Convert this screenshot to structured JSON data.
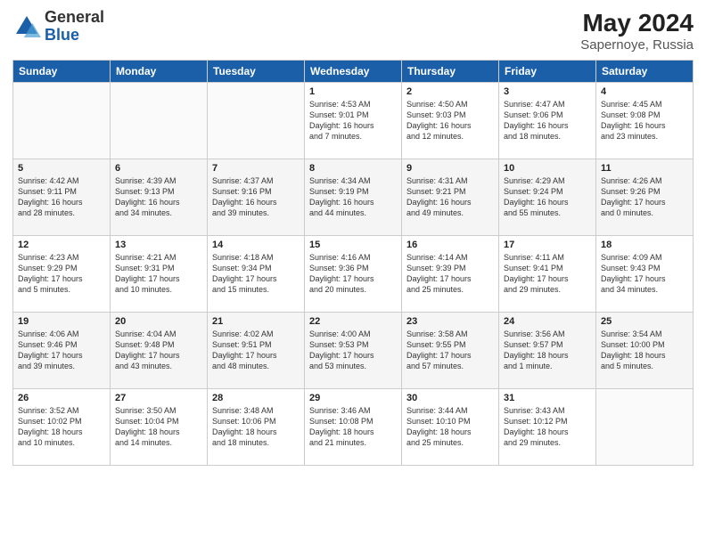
{
  "logo": {
    "general": "General",
    "blue": "Blue"
  },
  "title": "May 2024",
  "subtitle": "Sapernoye, Russia",
  "headers": [
    "Sunday",
    "Monday",
    "Tuesday",
    "Wednesday",
    "Thursday",
    "Friday",
    "Saturday"
  ],
  "weeks": [
    [
      {
        "day": "",
        "info": ""
      },
      {
        "day": "",
        "info": ""
      },
      {
        "day": "",
        "info": ""
      },
      {
        "day": "1",
        "info": "Sunrise: 4:53 AM\nSunset: 9:01 PM\nDaylight: 16 hours\nand 7 minutes."
      },
      {
        "day": "2",
        "info": "Sunrise: 4:50 AM\nSunset: 9:03 PM\nDaylight: 16 hours\nand 12 minutes."
      },
      {
        "day": "3",
        "info": "Sunrise: 4:47 AM\nSunset: 9:06 PM\nDaylight: 16 hours\nand 18 minutes."
      },
      {
        "day": "4",
        "info": "Sunrise: 4:45 AM\nSunset: 9:08 PM\nDaylight: 16 hours\nand 23 minutes."
      }
    ],
    [
      {
        "day": "5",
        "info": "Sunrise: 4:42 AM\nSunset: 9:11 PM\nDaylight: 16 hours\nand 28 minutes."
      },
      {
        "day": "6",
        "info": "Sunrise: 4:39 AM\nSunset: 9:13 PM\nDaylight: 16 hours\nand 34 minutes."
      },
      {
        "day": "7",
        "info": "Sunrise: 4:37 AM\nSunset: 9:16 PM\nDaylight: 16 hours\nand 39 minutes."
      },
      {
        "day": "8",
        "info": "Sunrise: 4:34 AM\nSunset: 9:19 PM\nDaylight: 16 hours\nand 44 minutes."
      },
      {
        "day": "9",
        "info": "Sunrise: 4:31 AM\nSunset: 9:21 PM\nDaylight: 16 hours\nand 49 minutes."
      },
      {
        "day": "10",
        "info": "Sunrise: 4:29 AM\nSunset: 9:24 PM\nDaylight: 16 hours\nand 55 minutes."
      },
      {
        "day": "11",
        "info": "Sunrise: 4:26 AM\nSunset: 9:26 PM\nDaylight: 17 hours\nand 0 minutes."
      }
    ],
    [
      {
        "day": "12",
        "info": "Sunrise: 4:23 AM\nSunset: 9:29 PM\nDaylight: 17 hours\nand 5 minutes."
      },
      {
        "day": "13",
        "info": "Sunrise: 4:21 AM\nSunset: 9:31 PM\nDaylight: 17 hours\nand 10 minutes."
      },
      {
        "day": "14",
        "info": "Sunrise: 4:18 AM\nSunset: 9:34 PM\nDaylight: 17 hours\nand 15 minutes."
      },
      {
        "day": "15",
        "info": "Sunrise: 4:16 AM\nSunset: 9:36 PM\nDaylight: 17 hours\nand 20 minutes."
      },
      {
        "day": "16",
        "info": "Sunrise: 4:14 AM\nSunset: 9:39 PM\nDaylight: 17 hours\nand 25 minutes."
      },
      {
        "day": "17",
        "info": "Sunrise: 4:11 AM\nSunset: 9:41 PM\nDaylight: 17 hours\nand 29 minutes."
      },
      {
        "day": "18",
        "info": "Sunrise: 4:09 AM\nSunset: 9:43 PM\nDaylight: 17 hours\nand 34 minutes."
      }
    ],
    [
      {
        "day": "19",
        "info": "Sunrise: 4:06 AM\nSunset: 9:46 PM\nDaylight: 17 hours\nand 39 minutes."
      },
      {
        "day": "20",
        "info": "Sunrise: 4:04 AM\nSunset: 9:48 PM\nDaylight: 17 hours\nand 43 minutes."
      },
      {
        "day": "21",
        "info": "Sunrise: 4:02 AM\nSunset: 9:51 PM\nDaylight: 17 hours\nand 48 minutes."
      },
      {
        "day": "22",
        "info": "Sunrise: 4:00 AM\nSunset: 9:53 PM\nDaylight: 17 hours\nand 53 minutes."
      },
      {
        "day": "23",
        "info": "Sunrise: 3:58 AM\nSunset: 9:55 PM\nDaylight: 17 hours\nand 57 minutes."
      },
      {
        "day": "24",
        "info": "Sunrise: 3:56 AM\nSunset: 9:57 PM\nDaylight: 18 hours\nand 1 minute."
      },
      {
        "day": "25",
        "info": "Sunrise: 3:54 AM\nSunset: 10:00 PM\nDaylight: 18 hours\nand 5 minutes."
      }
    ],
    [
      {
        "day": "26",
        "info": "Sunrise: 3:52 AM\nSunset: 10:02 PM\nDaylight: 18 hours\nand 10 minutes."
      },
      {
        "day": "27",
        "info": "Sunrise: 3:50 AM\nSunset: 10:04 PM\nDaylight: 18 hours\nand 14 minutes."
      },
      {
        "day": "28",
        "info": "Sunrise: 3:48 AM\nSunset: 10:06 PM\nDaylight: 18 hours\nand 18 minutes."
      },
      {
        "day": "29",
        "info": "Sunrise: 3:46 AM\nSunset: 10:08 PM\nDaylight: 18 hours\nand 21 minutes."
      },
      {
        "day": "30",
        "info": "Sunrise: 3:44 AM\nSunset: 10:10 PM\nDaylight: 18 hours\nand 25 minutes."
      },
      {
        "day": "31",
        "info": "Sunrise: 3:43 AM\nSunset: 10:12 PM\nDaylight: 18 hours\nand 29 minutes."
      },
      {
        "day": "",
        "info": ""
      }
    ]
  ]
}
